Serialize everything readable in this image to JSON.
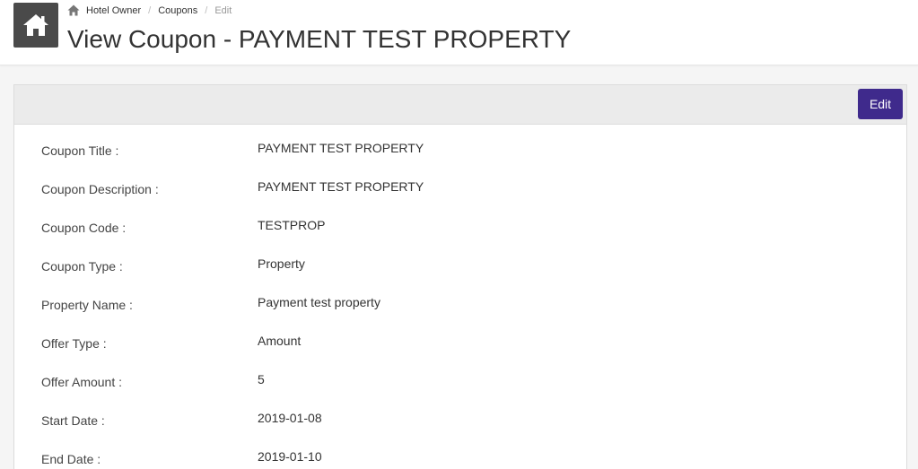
{
  "header": {
    "home_icon": "home-icon",
    "breadcrumb": {
      "home_icon": "home-icon",
      "items": [
        "Hotel Owner",
        "Coupons"
      ],
      "active": "Edit",
      "separator": "/"
    },
    "title": "View Coupon - PAYMENT TEST PROPERTY"
  },
  "panel": {
    "edit_label": "Edit",
    "rows": [
      {
        "label": "Coupon Title :",
        "value": "PAYMENT TEST PROPERTY"
      },
      {
        "label": "Coupon Description :",
        "value": "PAYMENT TEST PROPERTY"
      },
      {
        "label": "Coupon Code :",
        "value": "TESTPROP"
      },
      {
        "label": "Coupon Type :",
        "value": "Property"
      },
      {
        "label": "Property Name :",
        "value": "Payment test property"
      },
      {
        "label": "Offer Type :",
        "value": "Amount"
      },
      {
        "label": "Offer Amount :",
        "value": "5"
      },
      {
        "label": "Start Date :",
        "value": "2019-01-08"
      },
      {
        "label": "End Date :",
        "value": "2019-01-10"
      }
    ]
  },
  "colors": {
    "accent": "#3f2a8c",
    "home_tile": "#4a4a4a",
    "panel_header": "#ebebeb",
    "background": "#f5f5f5"
  }
}
